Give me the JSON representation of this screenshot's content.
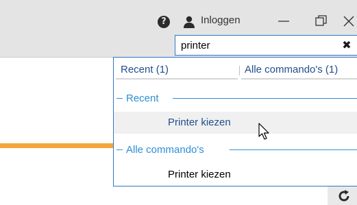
{
  "titlebar": {
    "help_icon": "question-circle-icon",
    "user_icon": "user-icon",
    "login_label": "Inloggen",
    "minimize_icon": "minimize-icon",
    "restore_icon": "restore-icon",
    "close_icon": "close-icon",
    "help_glyph": "?"
  },
  "search": {
    "value": "printer",
    "clear_glyph": "✖"
  },
  "dropdown": {
    "tabs": [
      {
        "label": "Recent  (1)"
      },
      {
        "label": "Alle commando's  (1)"
      }
    ],
    "sections": [
      {
        "title": "Recent",
        "items": [
          {
            "label": "Printer kiezen",
            "state": "hover"
          }
        ]
      },
      {
        "title": "Alle commando's",
        "items": [
          {
            "label": "Printer kiezen",
            "state": "normal"
          }
        ]
      }
    ]
  },
  "colors": {
    "accent_blue": "#2d8fd6",
    "border_blue": "#2e75c4",
    "orange": "#f3a63d",
    "titlebar_bg": "#e4e4e4"
  }
}
